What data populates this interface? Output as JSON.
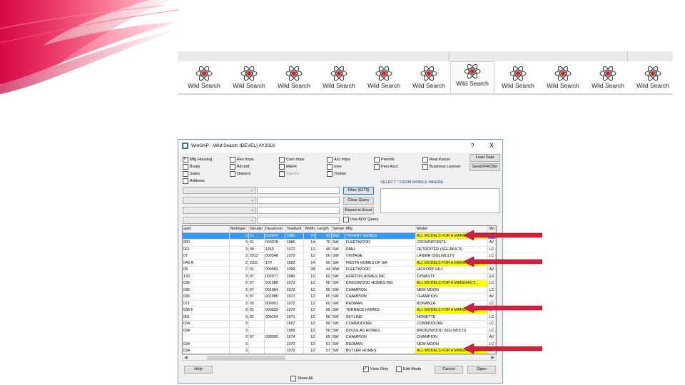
{
  "toolbar": {
    "buttons": [
      {
        "label": "Wild Search"
      },
      {
        "label": "Wild Search"
      },
      {
        "label": "Wild Search"
      },
      {
        "label": "Wild Search"
      },
      {
        "label": "Wild Search"
      },
      {
        "label": "Wild Search"
      },
      {
        "label": "Wild Search"
      },
      {
        "label": "Wild Search"
      },
      {
        "label": "Wild Search"
      },
      {
        "label": "Wild Search"
      },
      {
        "label": "Wild Search"
      }
    ],
    "active_index": 6
  },
  "window": {
    "title": "WinGAP - Wild Search (DEVEL) AY2016",
    "help_glyph": "?",
    "close_glyph": "X",
    "checkboxes": [
      {
        "label": "Mfg Housing",
        "checked": true
      },
      {
        "label": "Boats",
        "checked": false
      },
      {
        "label": "Sales",
        "checked": false
      },
      {
        "label": "Address",
        "checked": false
      },
      {
        "label": "Res Imps",
        "checked": false
      },
      {
        "label": "Aircraft",
        "checked": false
      },
      {
        "label": "Owners",
        "checked": false
      },
      {
        "label": "Com Imps",
        "checked": false
      },
      {
        "label": "MEFF",
        "checked": false
      },
      {
        "label": "Agents",
        "checked": false,
        "disabled": true
      },
      {
        "label": "Acc Imps",
        "checked": false
      },
      {
        "label": "Invn",
        "checked": false
      },
      {
        "label": "Timber",
        "checked": false
      },
      {
        "label": "Permits",
        "checked": false
      },
      {
        "label": "Pers Acct",
        "checked": false
      },
      {
        "label": "Real Parcel",
        "checked": false
      },
      {
        "label": "Business License",
        "checked": false
      }
    ],
    "buttons": {
      "load_data": "Load Data",
      "send2frc": "Send2FRCBin",
      "filter": "Filter (6279)",
      "clear_query": "Clear Query",
      "export": "Export to Excel",
      "help": "Help",
      "cancel": "Cancel",
      "open": "Open"
    },
    "use_adv_query": "Use ADV Query",
    "sql_label": "SELECT * FROM MOBILE WHERE",
    "view_only": "View Only",
    "edit_mode": "Edit Mode",
    "show_all": "Show All",
    "columns": [
      "apid",
      "Mobtype",
      "Decalyr",
      "Decalnum",
      "Yearbuilt",
      "Width",
      "Length",
      "Swmw",
      "Mfg",
      "Model",
      "Mo"
    ],
    "rows": [
      [
        "",
        "3",
        "01",
        "000641",
        "1980",
        "24",
        "52",
        "MW",
        "TIFFANY HOMES",
        "ALL MODELS FOR A MANUFACT...",
        "A"
      ],
      [
        "060",
        "3",
        "01",
        "000078",
        "1985",
        "14",
        "70",
        "SW",
        "FLEETWOOD",
        "CROWNPOINTE",
        "AV"
      ],
      [
        "061",
        "3",
        "09",
        "1253",
        "1972",
        "12",
        "48",
        "SW",
        "DMH",
        "DETROITER (SGL/MULTI)",
        "LC"
      ],
      [
        "07",
        "3",
        "2012",
        "000348",
        "1970",
        "12",
        "56",
        "SW",
        "VINTAGE",
        "LANIER (SGL/MULTI)",
        "LC"
      ],
      [
        "045 A",
        "3",
        "2011",
        "170",
        "1983",
        "14",
        "56",
        "SW",
        "FIESTA HOMES OF GA",
        "ALL MODELS FOR A MANUFACT...",
        "A"
      ],
      [
        "08",
        "2",
        "01",
        "000983",
        "1999",
        "28",
        "44",
        "MW",
        "FLEETWOOD",
        "HICKORY HILL",
        "AV"
      ],
      [
        "130",
        "3",
        "97",
        "002077",
        "1980",
        "12",
        "60",
        "SW",
        "HORTON HOMES INC",
        "DYNASTY",
        "EX"
      ],
      [
        "036",
        "3",
        "97",
        "001985",
        "1973",
        "12",
        "56",
        "SW",
        "KINGSWOOD HOMES INC",
        "ALL MODELS FOR A MANUFACT...",
        "LC"
      ],
      [
        "036",
        "3",
        "97",
        "001984",
        "1973",
        "12",
        "56",
        "SW",
        "CHAMPION",
        "NEW MOON",
        "LC"
      ],
      [
        "036",
        "3",
        "97",
        "001986",
        "1972",
        "12",
        "65",
        "SW",
        "CHAMPION",
        "CHAMPION",
        "AV"
      ],
      [
        "071",
        "3",
        "03",
        "000001",
        "1972",
        "12",
        "60",
        "SW",
        "REDMAN",
        "BONANZA",
        "LC"
      ],
      [
        "039 F",
        "3",
        "01",
        "000020",
        "1970",
        "12",
        "56",
        "SW",
        "TERRACE HOMES",
        "ALL MODELS FOR A MANUFACT...",
        "C"
      ],
      [
        "061",
        "3",
        "01",
        "000154",
        "1971",
        "12",
        "56",
        "SW",
        "SKYLINE",
        "HOMETTE",
        "LC"
      ],
      [
        "034",
        "3",
        "",
        "",
        "1967",
        "12",
        "56",
        "SW",
        "COMMODORE",
        "COMMODORE",
        "LC"
      ],
      [
        "034",
        "3",
        "",
        "",
        "1968",
        "12",
        "56",
        "SW",
        "DOUGLAS HOMES",
        "BRONZWOOD (SGL/MULTI)",
        "LC"
      ],
      [
        "",
        "3",
        "97",
        "003092",
        "1974",
        "12",
        "65",
        "SW",
        "CHAMPION",
        "CHAMPION",
        "AV"
      ],
      [
        "034",
        "3",
        "",
        "",
        "1970",
        "12",
        "61",
        "SW",
        "REDMAN",
        "NEW MOON",
        "LC"
      ],
      [
        "034",
        "3",
        "",
        "",
        "1970",
        "12",
        "57",
        "SW",
        "BUTLER HOMES",
        "ALL MODELS FOR A MANUFACT...",
        "A"
      ]
    ],
    "selected_row": 0,
    "highlight_value": "ALL MODELS FOR A MANUFACT...",
    "colors": {
      "selected": "#3399ff",
      "highlight": "#ffff00",
      "arrow": "#d61f3c"
    }
  }
}
